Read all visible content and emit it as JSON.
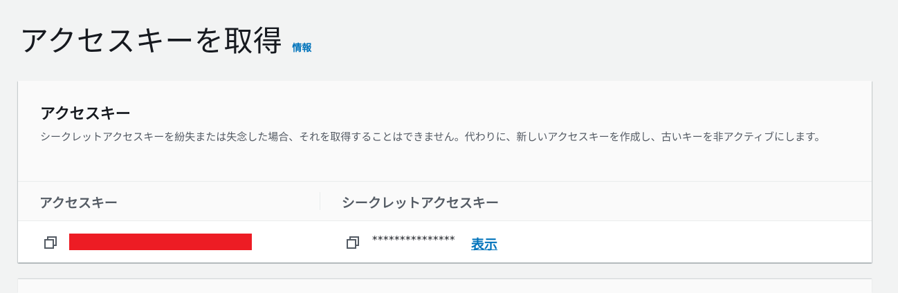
{
  "page": {
    "title": "アクセスキーを取得",
    "info_link": "情報"
  },
  "panel": {
    "title": "アクセスキー",
    "description": "シークレットアクセスキーを紛失または失念した場合、それを取得することはできません。代わりに、新しいアクセスキーを作成し、古いキーを非アクティブにします。",
    "columns": [
      "アクセスキー",
      "シークレットアクセスキー"
    ],
    "access_key": {
      "redacted": true,
      "redaction_color": "#ed1c24"
    },
    "secret_key": {
      "masked_value": "***************",
      "show_label": "表示"
    }
  },
  "colors": {
    "background": "#f2f3f3",
    "link": "#0073bb",
    "text": "#16191f",
    "secondary_text": "#545b64"
  },
  "icons": [
    "copy-icon",
    "copy-icon"
  ]
}
